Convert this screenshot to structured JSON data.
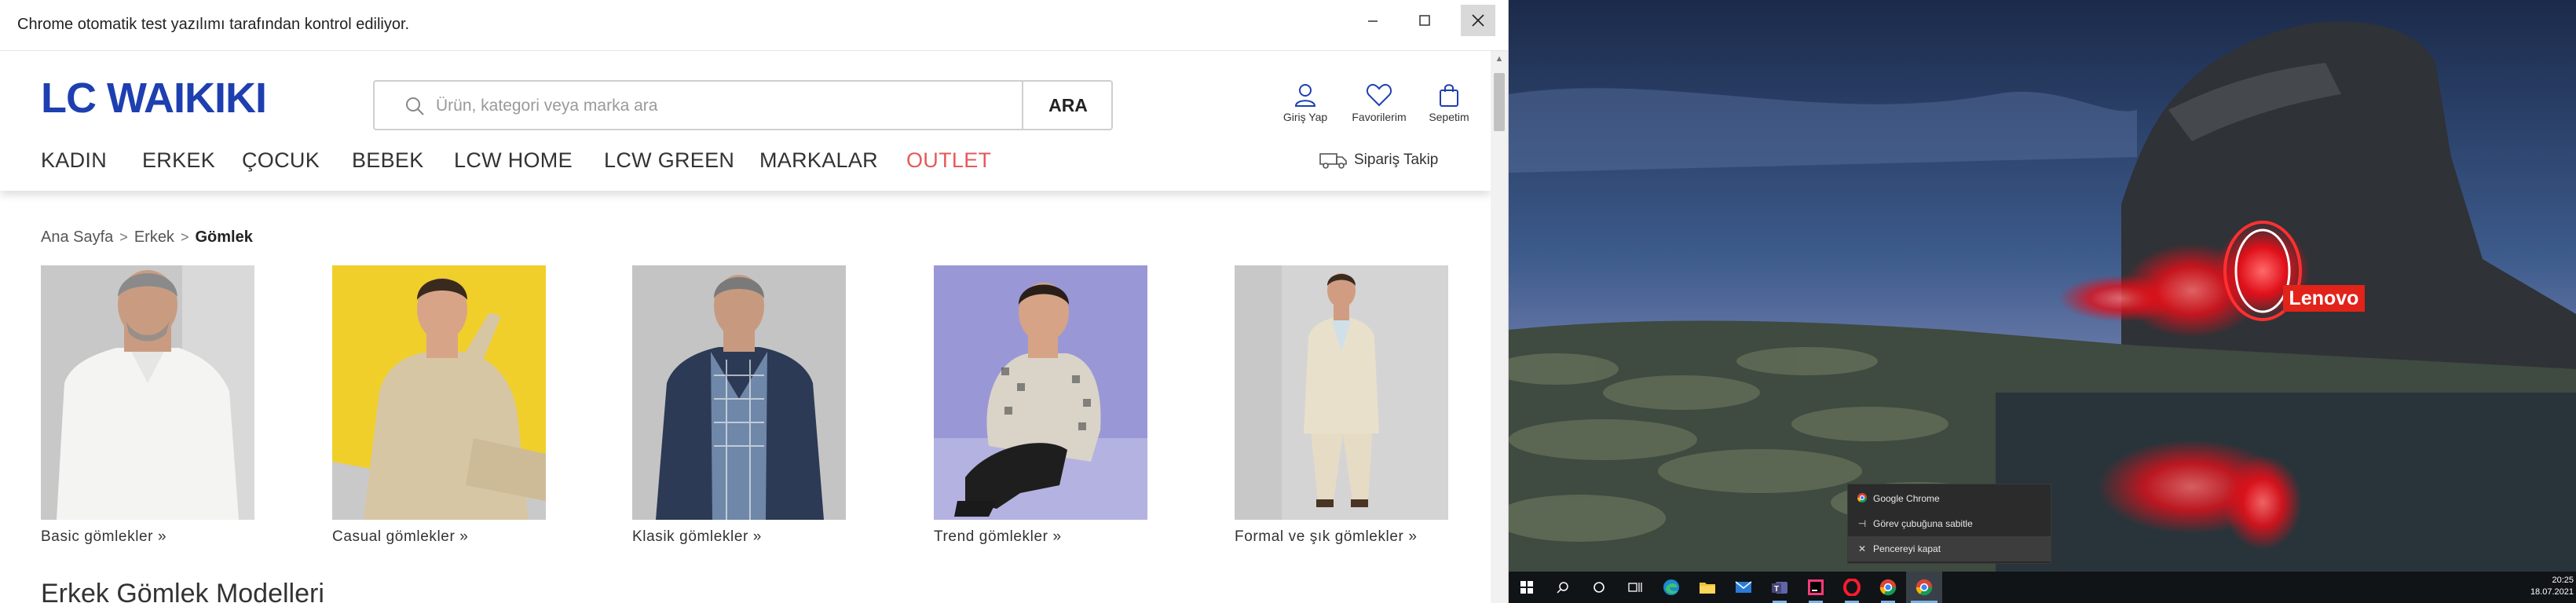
{
  "browser": {
    "automation_notice": "Chrome otomatik test yazılımı tarafından kontrol ediliyor.",
    "window_controls": [
      "minimize-icon",
      "maximize-icon",
      "close-icon"
    ]
  },
  "site": {
    "logo_text": "LC WAIKIKI",
    "brand_color": "#1e3fb0",
    "accent_red": "#e45a5a",
    "search": {
      "placeholder": "Ürün, kategori veya marka ara",
      "value": "",
      "button": "ARA"
    },
    "header_icons": [
      {
        "icon": "user-icon",
        "label": "Giriş Yap"
      },
      {
        "icon": "heart-icon",
        "label": "Favorilerim"
      },
      {
        "icon": "bag-icon",
        "label": "Sepetim"
      }
    ],
    "nav": [
      "KADIN",
      "ERKEK",
      "ÇOCUK",
      "BEBEK",
      "LCW HOME",
      "LCW GREEN",
      "MARKALAR",
      "OUTLET"
    ],
    "order_tracking": "Sipariş Takip",
    "breadcrumb": {
      "items": [
        "Ana Sayfa",
        "Erkek"
      ],
      "current": "Gömlek",
      "separator": ">"
    },
    "categories": [
      {
        "caption": "Basic gömlekler  »"
      },
      {
        "caption": "Casual gömlekler  »"
      },
      {
        "caption": "Klasik gömlekler  »"
      },
      {
        "caption": "Trend gömlekler  »"
      },
      {
        "caption": "Formal ve şık gömlekler »"
      }
    ],
    "section_title": "Erkek Gömlek Modelleri"
  },
  "desktop": {
    "wallpaper_badge": "Lenovo",
    "context_menu": [
      {
        "icon": "chrome-icon",
        "label": "Google Chrome"
      },
      {
        "icon": "pin-icon",
        "label": "Görev çubuğuna sabitle"
      },
      {
        "icon": "close-icon",
        "label": "Pencereyi kapat"
      }
    ],
    "taskbar": {
      "apps": [
        "start-icon",
        "search-icon",
        "cortana-icon",
        "task-view-icon",
        "edge-icon",
        "file-explorer-icon",
        "mail-icon",
        "teams-icon",
        "intellij-icon",
        "opera-icon",
        "chrome-icon",
        "chrome-icon"
      ],
      "time": "20:25",
      "date": "18.07.2021"
    }
  }
}
